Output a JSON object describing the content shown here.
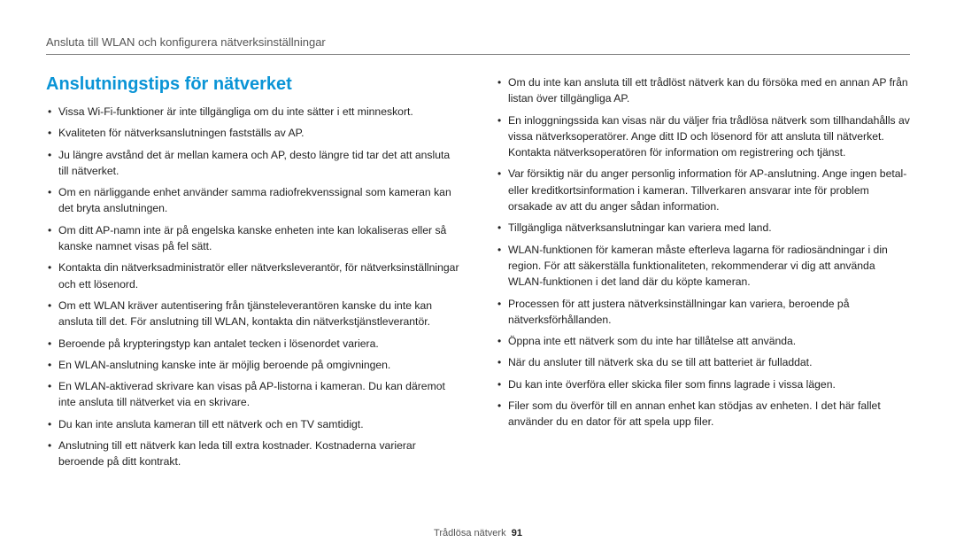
{
  "header": {
    "breadcrumb": "Ansluta till WLAN och konfigurera nätverksinställningar"
  },
  "section": {
    "title": "Anslutningstips för nätverket"
  },
  "tips": {
    "left": [
      "Vissa Wi-Fi-funktioner är inte tillgängliga om du inte sätter i ett minneskort.",
      "Kvaliteten för nätverksanslutningen fastställs av AP.",
      "Ju längre avstånd det är mellan kamera och AP, desto längre tid tar det att ansluta till nätverket.",
      "Om en närliggande enhet använder samma radiofrekvenssignal som kameran kan det bryta anslutningen.",
      "Om ditt AP-namn inte är på engelska kanske enheten inte kan lokaliseras eller så kanske namnet visas på fel sätt.",
      "Kontakta din nätverksadministratör eller nätverksleverantör, för nätverksinställningar och ett lösenord.",
      "Om ett WLAN kräver autentisering från tjänsteleverantören kanske du inte kan ansluta till det. För anslutning till WLAN, kontakta din nätverkstjänstleverantör.",
      "Beroende på krypteringstyp kan antalet tecken i lösenordet variera.",
      "En WLAN-anslutning kanske inte är möjlig beroende på omgivningen.",
      "En WLAN-aktiverad skrivare kan visas på AP-listorna i kameran. Du kan däremot inte ansluta till nätverket via en skrivare.",
      "Du kan inte ansluta kameran till ett nätverk och en TV samtidigt.",
      "Anslutning till ett nätverk kan leda till extra kostnader. Kostnaderna varierar beroende på ditt kontrakt."
    ],
    "right": [
      "Om du inte kan ansluta till ett trådlöst nätverk kan du försöka med en annan AP från listan över tillgängliga AP.",
      "En inloggningssida kan visas när du väljer fria trådlösa nätverk som tillhandahålls av vissa nätverksoperatörer. Ange ditt ID och lösenord för att ansluta till nätverket. Kontakta nätverksoperatören för information om registrering och tjänst.",
      "Var försiktig när du anger personlig information för AP-anslutning. Ange ingen betal- eller kreditkortsinformation i kameran. Tillverkaren ansvarar inte för problem orsakade av att du anger sådan information.",
      "Tillgängliga nätverksanslutningar kan variera med land.",
      "WLAN-funktionen för kameran måste efterleva lagarna för radiosändningar i din region. För att säkerställa funktionaliteten, rekommenderar vi dig att använda WLAN-funktionen i det land där du köpte kameran.",
      "Processen för att justera nätverksinställningar kan variera, beroende på nätverksförhållanden.",
      "Öppna inte ett nätverk som du inte har tillåtelse att använda.",
      "När du ansluter till nätverk ska du se till att batteriet är fulladdat.",
      "Du kan inte överföra eller skicka filer som finns lagrade i vissa lägen.",
      "Filer som du överför till en annan enhet kan stödjas av enheten. I det här fallet använder du en dator för att spela upp filer."
    ]
  },
  "footer": {
    "section": "Trådlösa nätverk",
    "page": "91"
  }
}
